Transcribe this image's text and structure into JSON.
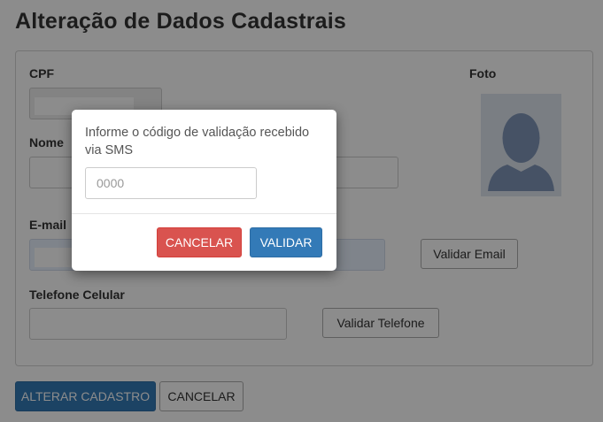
{
  "page": {
    "title": "Alteração de Dados Cadastrais"
  },
  "form": {
    "cpf_label": "CPF",
    "photo_label": "Foto",
    "name_label": "Nome",
    "email_label": "E-mail",
    "phone_label": "Telefone Celular",
    "validate_email_label": "Validar Email",
    "validate_phone_label": "Validar Telefone"
  },
  "actions": {
    "submit_label": "ALTERAR CADASTRO",
    "cancel_label": "CANCELAR"
  },
  "modal": {
    "message": "Informe o código de validação recebido via SMS",
    "code_placeholder": "0000",
    "cancel_label": "CANCELAR",
    "validate_label": "VALIDAR"
  },
  "colors": {
    "primary": "#337ab7",
    "danger": "#d9534f"
  },
  "icons": {
    "photo": "user-silhouette-icon"
  }
}
